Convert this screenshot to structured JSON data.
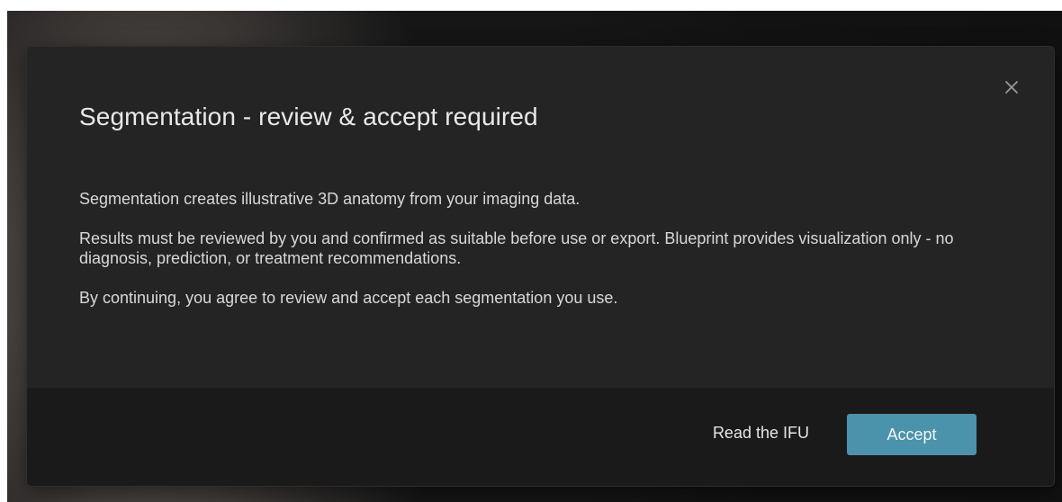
{
  "dialog": {
    "title": "Segmentation - review & accept required",
    "paragraphs": [
      "Segmentation creates illustrative 3D anatomy from your imaging data.",
      "Results must be reviewed by you and confirmed as suitable before use or export. Blueprint provides visualization only - no diagnosis, prediction, or treatment recommendations.",
      "By continuing, you agree to review and accept each segmentation you use."
    ],
    "close_icon": "close-icon",
    "footer": {
      "secondary_label": "Read the IFU",
      "primary_label": "Accept"
    }
  },
  "colors": {
    "accent": "#4a93aa",
    "dialog_bg": "#242424",
    "footer_bg": "#1a1a1a"
  }
}
